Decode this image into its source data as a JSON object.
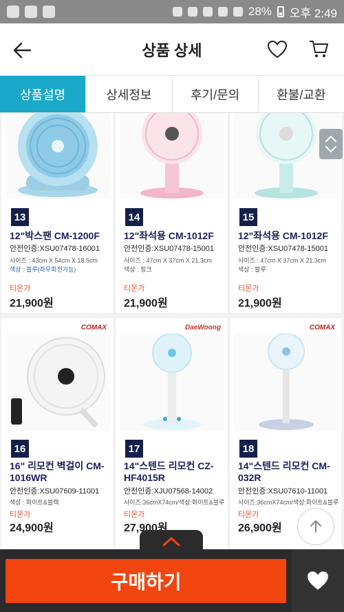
{
  "status_bar": {
    "battery": "28%",
    "time": "오후 2:49"
  },
  "header": {
    "title": "상품 상세"
  },
  "tabs": [
    {
      "label": "상품설명",
      "active": true
    },
    {
      "label": "상세정보",
      "active": false
    },
    {
      "label": "후기/문의",
      "active": false
    },
    {
      "label": "환불/교환",
      "active": false
    }
  ],
  "products": [
    {
      "num": "13",
      "name": "12\"박스팬 CM-1200F",
      "cert": "안전인증:XSU07478-16001",
      "spec": "사이즈 : 43cm X 54cm X 18.5cm",
      "color": "색상 : 블루(좌우회전가능)",
      "seller": "티몬가",
      "price": "21,900원"
    },
    {
      "num": "14",
      "name": "12\"좌석용 CM-1012F",
      "cert": "안전인증:XSU07478-15001",
      "spec": "사이즈 : 47cm X 37cm X 21.3cm",
      "color": "색상 : 핑크",
      "seller": "티몬가",
      "price": "21,900원"
    },
    {
      "num": "15",
      "name": "12\"좌석용 CM-1012F",
      "cert": "안전인증:XSU07478-15001",
      "spec": "사이즈 : 47cm X 37cm X 21.3cm",
      "color": "색상 : 블루",
      "seller": "티몬가",
      "price": "21,900원"
    },
    {
      "num": "16",
      "name": "16\" 리모컨 벽걸이 CM-1016WR",
      "cert": "안전인증:XSU07609-11001",
      "spec": "색상 : 화이트&블랙",
      "color": "",
      "seller": "티몬가",
      "price": "24,900원",
      "brand": "COMAX"
    },
    {
      "num": "17",
      "name": "14\"스텐드 리모컨 CZ-HF4015R",
      "cert": "안전인증:XJU07568-14002",
      "spec": "사이즈:36cmX74cm/색상:화이트&블루",
      "color": "",
      "seller": "티몬가",
      "price": "27,900원",
      "brand": "DaeWoong"
    },
    {
      "num": "18",
      "name": "14\"스텐드 리모컨 CM-032R",
      "cert": "안전인증:XSU07610-11001",
      "spec": "사이즈:36cmX74cm/색상:화이트&블루",
      "color": "",
      "seller": "티몬가",
      "price": "26,900원",
      "brand": "COMAX"
    }
  ],
  "buy_button": "구매하기",
  "colors": {
    "accent": "#1aa9c8",
    "buy": "#f2450f",
    "bottom_bar": "#2b2b2b"
  },
  "icons": [
    "back-arrow-icon",
    "heart-icon",
    "cart-icon",
    "chevron-up-icon",
    "chevron-down-icon",
    "arrow-up-icon"
  ]
}
